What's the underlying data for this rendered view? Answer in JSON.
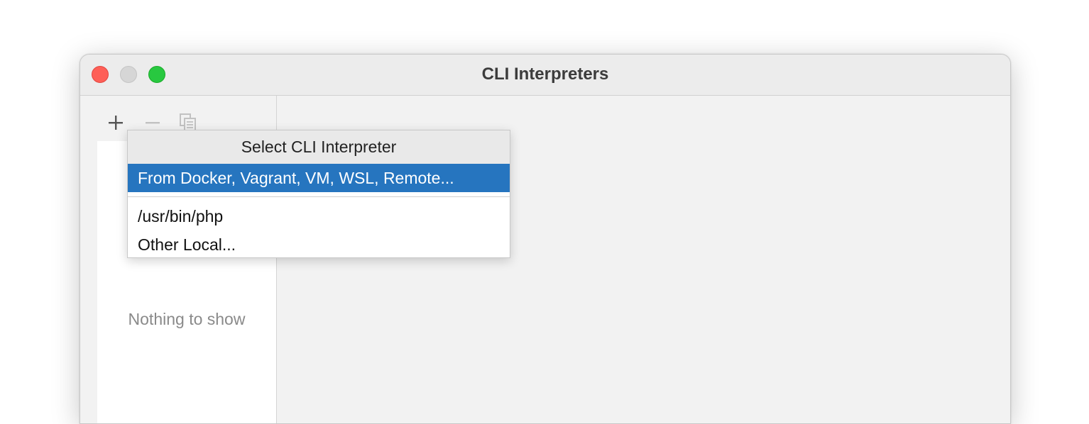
{
  "window": {
    "title": "CLI Interpreters"
  },
  "toolbar": {
    "add_icon": "plus-icon",
    "remove_icon": "minus-icon",
    "copy_icon": "copy-icon"
  },
  "list": {
    "empty_text": "Nothing to show"
  },
  "popup": {
    "header": "Select CLI Interpreter",
    "items": [
      {
        "label": "From Docker, Vagrant, VM, WSL, Remote...",
        "selected": true
      },
      {
        "label": "/usr/bin/php",
        "selected": false
      },
      {
        "label": "Other Local...",
        "selected": false
      }
    ]
  },
  "colors": {
    "selection": "#2675bf",
    "close": "#fe5f57",
    "minimize": "#d6d6d6",
    "maximize": "#28c840"
  }
}
